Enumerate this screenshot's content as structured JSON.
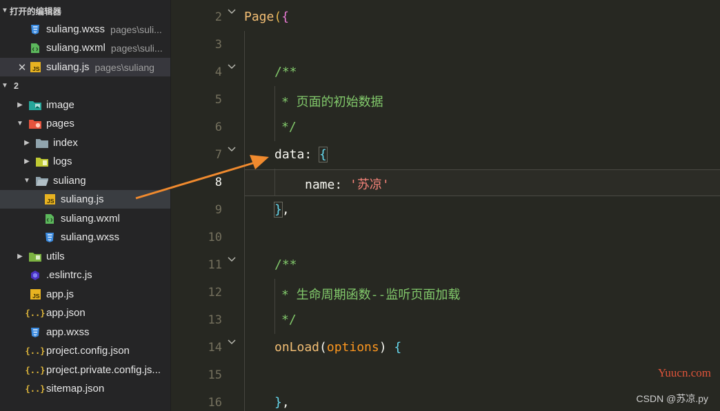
{
  "sidebar": {
    "open_editors_title": "打开的编辑器",
    "open_editors": [
      {
        "name": "suliang.wxss",
        "path": "pages\\suli..."
      },
      {
        "name": "suliang.wxml",
        "path": "pages\\suli..."
      },
      {
        "name": "suliang.js",
        "path": "pages\\suliang"
      }
    ],
    "project_title": "2",
    "tree": [
      {
        "name": "image"
      },
      {
        "name": "pages"
      },
      {
        "name": "index"
      },
      {
        "name": "logs"
      },
      {
        "name": "suliang"
      },
      {
        "name": "suliang.js"
      },
      {
        "name": "suliang.wxml"
      },
      {
        "name": "suliang.wxss"
      },
      {
        "name": "utils"
      },
      {
        "name": ".eslintrc.js"
      },
      {
        "name": "app.js"
      },
      {
        "name": "app.json"
      },
      {
        "name": "app.wxss"
      },
      {
        "name": "project.config.json"
      },
      {
        "name": "project.private.config.js..."
      },
      {
        "name": "sitemap.json"
      }
    ]
  },
  "editor": {
    "line_numbers": [
      "2",
      "3",
      "4",
      "5",
      "6",
      "7",
      "8",
      "9",
      "10",
      "11",
      "12",
      "13",
      "14",
      "15",
      "16"
    ],
    "current_line": "8",
    "code": {
      "l2_page": "Page",
      "l2_paren": "(",
      "l2_brace": "{",
      "l4_comment": "/**",
      "l5_comment": "* 页面的初始数据",
      "l6_comment": "*/",
      "l7_key": "data",
      "l7_colon": ": ",
      "l7_brace": "{",
      "l8_key": "name",
      "l8_colon": ": ",
      "l8_value": "'苏凉'",
      "l9_brace": "}",
      "l9_comma": ",",
      "l11_comment": "/**",
      "l12_comment": "* 生命周期函数--监听页面加载",
      "l13_comment": "*/",
      "l14_fn": "onLoad",
      "l14_paren_open": "(",
      "l14_param": "options",
      "l14_paren_close": ")",
      "l14_brace": " {",
      "l16_brace": "}",
      "l16_comma": ","
    }
  },
  "watermarks": {
    "site": "Yuucn.com",
    "csdn": "CSDN @苏凉.py"
  },
  "colors": {
    "arrow": "#f08a2e"
  }
}
